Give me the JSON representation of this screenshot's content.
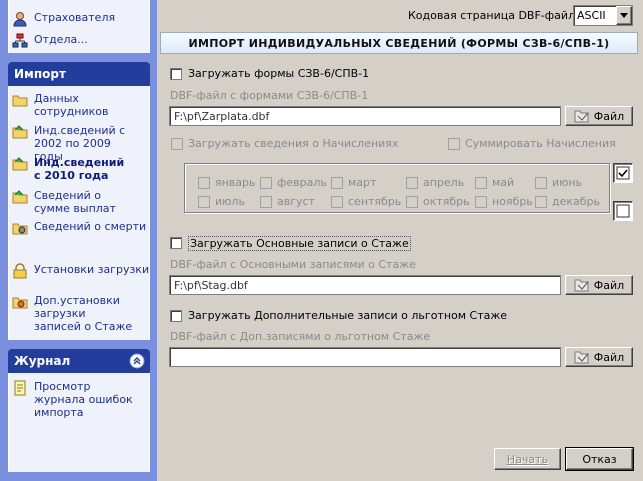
{
  "sidebar": {
    "top_items": [
      {
        "label": "Страхователя",
        "icon": "user-icon"
      },
      {
        "label": "Отдела...",
        "icon": "org-chart-icon"
      }
    ],
    "import_section": {
      "title": "Импорт",
      "items": [
        {
          "label": "Данных сотрудников",
          "icon": "folder-icon"
        },
        {
          "label": "Инд.сведений с 2002 по 2009 годы",
          "icon": "folder-green-icon"
        },
        {
          "label": "Инд.сведений с 2010 года",
          "icon": "folder-green-icon"
        },
        {
          "label": "Сведений о сумме выплат",
          "icon": "folder-green-icon"
        },
        {
          "label": "Сведений о смерти",
          "icon": "folder-icon"
        },
        {
          "label": "Установки загрузки",
          "icon": "lock-icon"
        },
        {
          "label": "Доп.установки загрузки записей о Стаже",
          "icon": "folder-settings-icon"
        }
      ]
    },
    "journal_section": {
      "title": "Журнал",
      "items": [
        {
          "label": "Просмотр журнала ошибок импорта",
          "icon": "notepad-icon"
        }
      ]
    }
  },
  "main": {
    "codepage_label": "Кодовая страница DBF-файлов:",
    "codepage_value": "ASCII",
    "title": "ИМПОРТ ИНДИВИДУАЛЬНЫХ СВЕДЕНИЙ (ФОРМЫ СЗВ-6/СПВ-1)",
    "section1": {
      "checkbox_label": "Загружать формы СЗВ-6/СПВ-1",
      "file_label": "DBF-файл с формами СЗВ-6/СПВ-1",
      "file_value": "F:\\pf\\Zarplata.dbf",
      "browse": "Файл",
      "accruals_label": "Загружать сведения о Начислениях",
      "sum_label": "Суммировать Начисления",
      "months": [
        "январь",
        "февраль",
        "март",
        "апрель",
        "май",
        "июнь",
        "июль",
        "август",
        "сентябрь",
        "октябрь",
        "ноябрь",
        "декабрь"
      ]
    },
    "section2": {
      "checkbox_label": "Загружать Основные записи о Стаже",
      "file_label": "DBF-файл с Основными записями о Стаже",
      "file_value": "F:\\pf\\Stag.dbf",
      "browse": "Файл"
    },
    "section3": {
      "checkbox_label": "Загружать Дополнительные записи о льготном Стаже",
      "file_label": "DBF-файл с Доп.записями о льготном Стаже",
      "file_value": "",
      "browse": "Файл"
    },
    "start_button": "Начать",
    "cancel_button": "Отказ"
  }
}
